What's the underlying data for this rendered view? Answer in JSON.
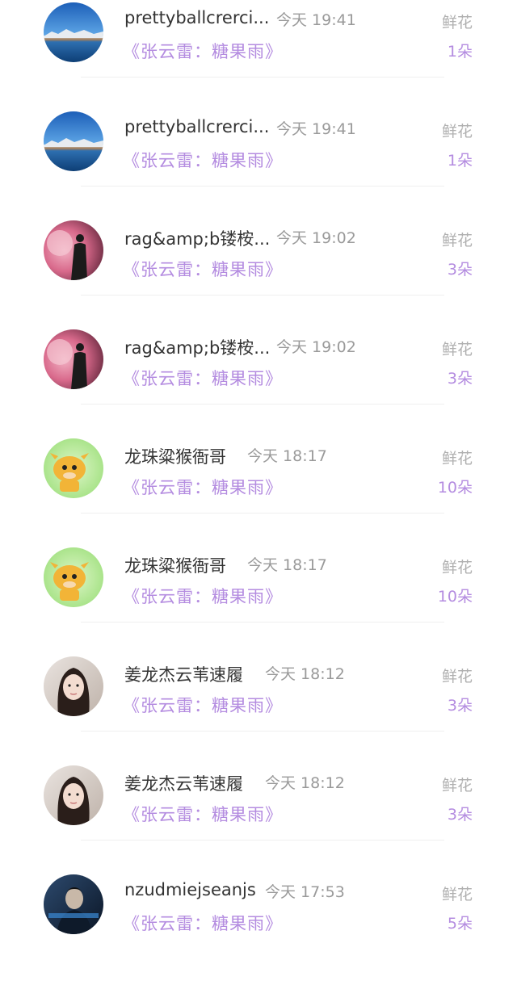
{
  "gift_list": [
    {
      "name": "prettyballcrerci...",
      "time": "今天 19:41",
      "song": "《张云雷：糖果雨》",
      "gift_label": "鲜花",
      "gift_count": "1朵",
      "avatar": "lake-mountain-photo"
    },
    {
      "name": "prettyballcrerci...",
      "time": "今天 19:41",
      "song": "《张云雷：糖果雨》",
      "gift_label": "鲜花",
      "gift_count": "1朵",
      "avatar": "lake-mountain-photo"
    },
    {
      "name": "rag&amp;b镂桉...",
      "time": "今天 19:02",
      "song": "《张云雷：糖果雨》",
      "gift_label": "鲜花",
      "gift_count": "3朵",
      "avatar": "smoke-silhouette-photo"
    },
    {
      "name": "rag&amp;b镂桉...",
      "time": "今天 19:02",
      "song": "《张云雷：糖果雨》",
      "gift_label": "鲜花",
      "gift_count": "3朵",
      "avatar": "smoke-silhouette-photo"
    },
    {
      "name": "龙珠粱猴衙哥",
      "time": "今天 18:17",
      "song": "《张云雷：糖果雨》",
      "gift_label": "鲜花",
      "gift_count": "10朵",
      "avatar": "cartoon-cow"
    },
    {
      "name": "龙珠粱猴衙哥",
      "time": "今天 18:17",
      "song": "《张云雷：糖果雨》",
      "gift_label": "鲜花",
      "gift_count": "10朵",
      "avatar": "cartoon-cow"
    },
    {
      "name": "姜龙杰云苇速履",
      "time": "今天 18:12",
      "song": "《张云雷：糖果雨》",
      "gift_label": "鲜花",
      "gift_count": "3朵",
      "avatar": "girl-portrait"
    },
    {
      "name": "姜龙杰云苇速履",
      "time": "今天 18:12",
      "song": "《张云雷：糖果雨》",
      "gift_label": "鲜花",
      "gift_count": "3朵",
      "avatar": "girl-portrait"
    },
    {
      "name": "nzudmiejseanjs",
      "time": "今天 17:53",
      "song": "《张云雷：糖果雨》",
      "gift_label": "鲜花",
      "gift_count": "5朵",
      "avatar": "dark-portrait"
    }
  ],
  "colors": {
    "name_text": "#333333",
    "time_text": "#9a9a9a",
    "accent_purple": "#b48ce0",
    "label_gray": "#b0b0b0"
  }
}
